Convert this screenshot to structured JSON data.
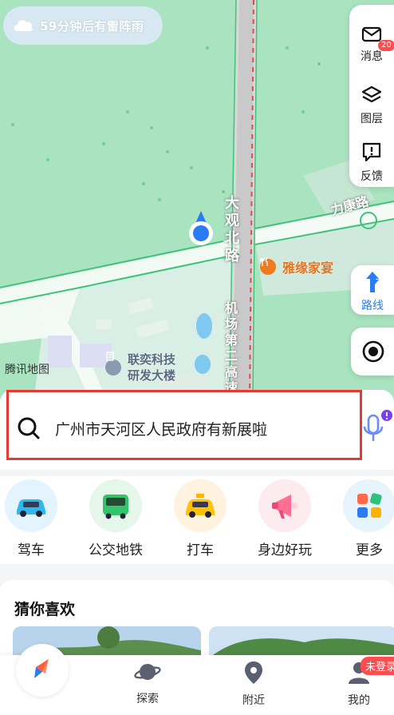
{
  "weather": {
    "text": "59分钟后有雷阵雨",
    "icon": "cloud-icon"
  },
  "right_panel": [
    {
      "label": "消息",
      "icon": "mail-icon",
      "badge": "20"
    },
    {
      "label": "图层",
      "icon": "layers-icon"
    },
    {
      "label": "反馈",
      "icon": "feedback-icon"
    }
  ],
  "map": {
    "labels": {
      "road1": "大观北路",
      "road2": "力康路",
      "road3": "机场第二高速",
      "poi1": "雅缘家宴",
      "poi2_line1": "联奕科技",
      "poi2_line2": "研发大楼",
      "attribution": "腾讯地图"
    }
  },
  "route_button": {
    "label": "路线",
    "icon": "route-arrow-icon"
  },
  "locate_button": {
    "icon": "locate-icon"
  },
  "search": {
    "placeholder": "广州市天河区人民政府有新展啦",
    "icon": "search-icon",
    "mic_icon": "mic-icon"
  },
  "quick_actions": [
    {
      "label": "驾车",
      "icon": "car-icon"
    },
    {
      "label": "公交地铁",
      "icon": "bus-icon"
    },
    {
      "label": "打车",
      "icon": "taxi-icon"
    },
    {
      "label": "身边好玩",
      "icon": "megaphone-icon"
    },
    {
      "label": "更多",
      "icon": "grid-more-icon"
    }
  ],
  "feed": {
    "title": "猜你喜欢"
  },
  "tabbar": {
    "home_icon": "compass-icon",
    "tabs": [
      {
        "label": "探索",
        "icon": "planet-icon"
      },
      {
        "label": "附近",
        "icon": "pin-icon"
      },
      {
        "label": "我的",
        "icon": "user-icon"
      }
    ],
    "login_badge": "未登录"
  },
  "colors": {
    "accent": "#2a7bf4",
    "map_green": "#a9e3c0",
    "highlight_red": "#e53935",
    "poi_orange": "#ef7b21"
  }
}
